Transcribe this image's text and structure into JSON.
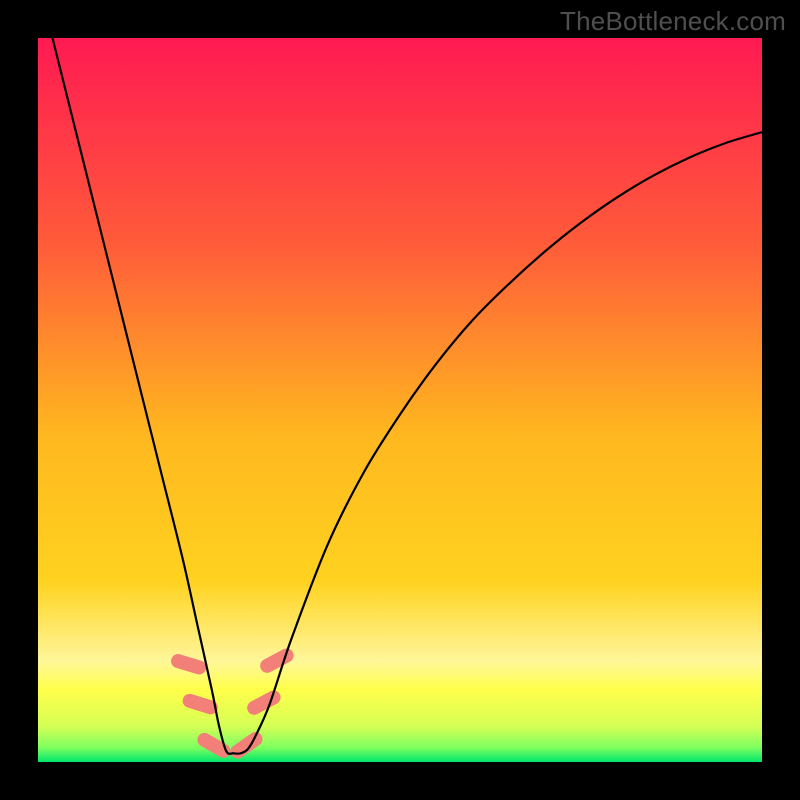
{
  "watermark": "TheBottleneck.com",
  "chart_data": {
    "type": "line",
    "title": "",
    "xlabel": "",
    "ylabel": "",
    "xlim": [
      0,
      100
    ],
    "ylim": [
      0,
      100
    ],
    "background_gradient": {
      "top": "#ff1a52",
      "upper_mid": "#ff7a2f",
      "mid": "#ffd21f",
      "lower_mid": "#fff69a",
      "band": "#ffff4a",
      "bottom": "#00e66b"
    },
    "curve_comment": "V-shaped bottleneck curve. Values are percentage height (0 at bottom, 100 at top). Curve reaches minimum near x≈26.",
    "series": [
      {
        "name": "bottleneck-curve",
        "x": [
          2,
          5,
          8,
          11,
          14,
          17,
          20,
          22,
          24,
          25,
          26,
          27,
          28,
          29,
          30,
          32,
          35,
          40,
          45,
          50,
          55,
          60,
          65,
          70,
          75,
          80,
          85,
          90,
          95,
          100
        ],
        "y": [
          100,
          88,
          76,
          64,
          52,
          40,
          28,
          19,
          10,
          5,
          1.5,
          1.2,
          1.2,
          1.8,
          3.5,
          8,
          17,
          30,
          40,
          48,
          55,
          61,
          66,
          70.5,
          74.5,
          78,
          81,
          83.5,
          85.5,
          87
        ]
      }
    ],
    "markers": {
      "comment": "Short salmon-colored dash segments near the curve bottom.",
      "color": "#f27f78",
      "segments": [
        {
          "x": 20.8,
          "y": 13.5,
          "angle": -73
        },
        {
          "x": 22.4,
          "y": 8.0,
          "angle": -73
        },
        {
          "x": 24.3,
          "y": 2.3,
          "angle": -60
        },
        {
          "x": 28.8,
          "y": 2.3,
          "angle": 55
        },
        {
          "x": 31.2,
          "y": 8.2,
          "angle": 62
        },
        {
          "x": 33.0,
          "y": 14.0,
          "angle": 62
        }
      ]
    }
  }
}
